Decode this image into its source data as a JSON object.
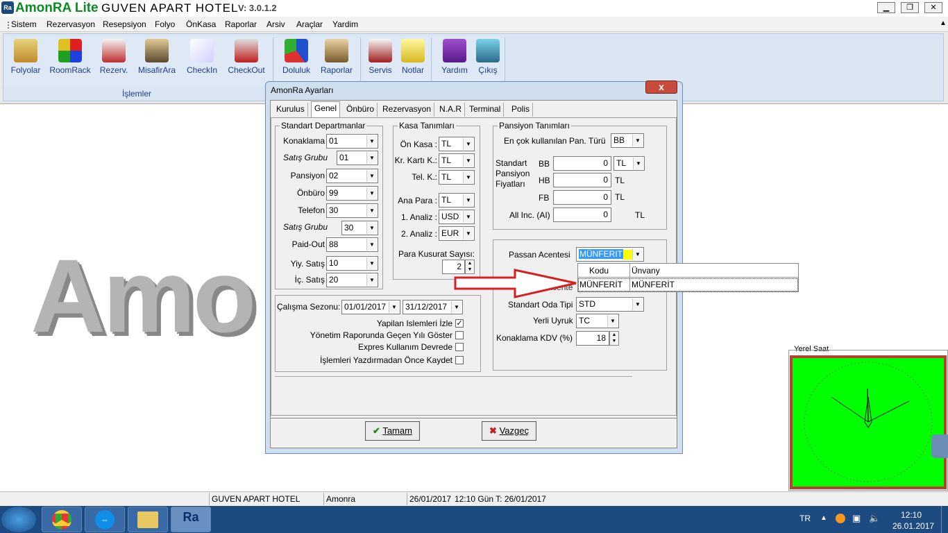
{
  "window": {
    "app_name": "AmonRA Lite",
    "hotel": "GUVEN APART HOTEL",
    "version": "V: 3.0.1.2",
    "logo": "Ra"
  },
  "menu": [
    "Sistem",
    "Rezervasyon",
    "Resepsiyon",
    "Folyo",
    "ÖnKasa",
    "Raporlar",
    "Arsiv",
    "Araçlar",
    "Yardim"
  ],
  "ribbon": {
    "buttons": [
      "Folyolar",
      "RoomRack",
      "Rezerv.",
      "MisafirAra",
      "CheckIn",
      "CheckOut",
      "Doluluk",
      "Raporlar",
      "Servis",
      "Notlar",
      "Yardım",
      "Çıkış"
    ],
    "group_label": "İşlemler"
  },
  "background_text": "Amo",
  "dialog": {
    "title": "AmonRa Ayarları",
    "close": "x",
    "tabs": [
      "Kurulus",
      "Genel",
      "Önbüro",
      "Rezervasyon",
      "N.A.R",
      "Terminal",
      "Polis"
    ],
    "departments": {
      "title": "Standart Departmanlar",
      "rows": [
        {
          "label": "Konaklama",
          "value": "01"
        },
        {
          "label": "Satış Grubu",
          "value": "01"
        },
        {
          "label": "Pansiyon",
          "value": "02"
        },
        {
          "label": "Önbüro",
          "value": "99"
        },
        {
          "label": "Telefon",
          "value": "30"
        },
        {
          "label": "Satış Grubu",
          "value": "30"
        },
        {
          "label": "Paid-Out",
          "value": "88"
        },
        {
          "label": "Yiy. Satış",
          "value": "10"
        },
        {
          "label": "İç. Satış",
          "value": "20"
        }
      ]
    },
    "cash": {
      "title": "Kasa Tanımları",
      "rows": [
        {
          "label": "Ön Kasa :",
          "value": "TL"
        },
        {
          "label": "Kr. Kartı K.:",
          "value": "TL"
        },
        {
          "label": "Tel. K.:",
          "value": "TL"
        },
        {
          "label": "Ana Para :",
          "value": "TL"
        },
        {
          "label": "1. Analiz :",
          "value": "USD"
        },
        {
          "label": "2. Analiz :",
          "value": "EUR"
        }
      ],
      "decimal_label": "Para Kusurat Sayısı:",
      "decimal_value": "2"
    },
    "pension": {
      "title": "Pansiyon Tanımları",
      "most_used_label": "En çok kullanılan Pan. Türü",
      "most_used_value": "BB",
      "std_label": "Standart Pansiyon Fiyatları",
      "rows": [
        {
          "label": "BB",
          "value": "0",
          "cur": "TL"
        },
        {
          "label": "HB",
          "value": "0",
          "cur": "TL"
        },
        {
          "label": "FB",
          "value": "0",
          "cur": "TL"
        },
        {
          "label": "All Inc. (AI)",
          "value": "0",
          "cur": "TL"
        }
      ]
    },
    "season": {
      "label": "Çalışma Sezonu:",
      "from": "01/01/2017",
      "to": "31/12/2017",
      "checks": [
        {
          "label": "Yapilan Islemleri İzle",
          "checked": "✓"
        },
        {
          "label": "Yönetim Raporunda Geçen Yılı Göster",
          "checked": ""
        },
        {
          "label": "Expres Kullanım Devrede",
          "checked": ""
        },
        {
          "label": "İşlemleri Yazdırmadan Önce Kaydet",
          "checked": ""
        }
      ]
    },
    "agency": {
      "passan_label": "Passan Acentesi",
      "passan_value": "MÜNFERIT",
      "std_agency_label": "Standart Acente",
      "room_label": "Standart Oda Tipi",
      "room_value": "STD",
      "nation_label": "Yerli Uyruk",
      "nation_value": "TC",
      "kdv_label": "Konaklama KDV (%)",
      "kdv_value": "18"
    },
    "dropdown": {
      "headers": [
        "Kodu",
        "Ünvany"
      ],
      "row": [
        "MÜNFERİT",
        "MÜNFERİT"
      ]
    },
    "ok": "Tamam",
    "cancel": "Vazgeç"
  },
  "clock": {
    "label": "Yerel Saat"
  },
  "status": {
    "hotel": "GUVEN APART HOTEL",
    "user": "Amonra SÜPERVISOR",
    "date": "26/01/2017",
    "info": "12:10 Gün T: 26/01/2017"
  },
  "taskbar": {
    "lang": "TR",
    "time": "12:10",
    "date": "26.01.2017"
  },
  "colors": {
    "clock_bg": "#00ff00",
    "arrow": "#d42020",
    "title_green": "#0a8c22",
    "taskbar": "#1e4a82"
  }
}
